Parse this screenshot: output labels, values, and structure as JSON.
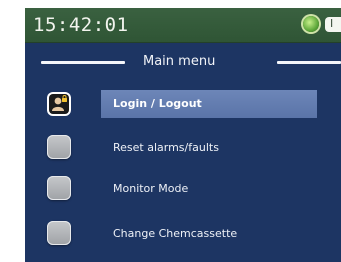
{
  "status_bar": {
    "time": "15:42:01",
    "pill_text": "I",
    "indicator_color": "#5fa83a"
  },
  "menu": {
    "title": "Main menu",
    "items": [
      {
        "label": "Login / Logout",
        "selected": true,
        "icon": "user-lock-icon"
      },
      {
        "label": "Reset alarms/faults",
        "selected": false,
        "icon": "blank-button-icon"
      },
      {
        "label": "Monitor Mode",
        "selected": false,
        "icon": "blank-button-icon"
      },
      {
        "label": "Change Chemcassette",
        "selected": false,
        "icon": "blank-button-icon"
      }
    ]
  },
  "colors": {
    "background": "#1d3563",
    "status_bar": "#2f5535",
    "highlight": "#5f78ab"
  }
}
